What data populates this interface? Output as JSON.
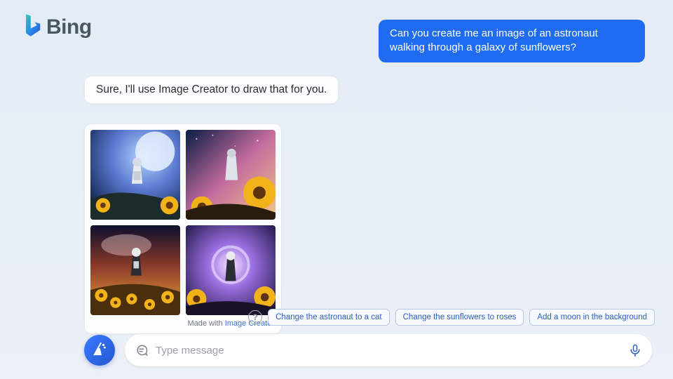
{
  "brand": {
    "name": "Bing"
  },
  "chat": {
    "user_message": "Can you create me an image of an astronaut walking through a galaxy of sunflowers?",
    "bot_message": "Sure, I'll use Image Creator to draw that for you.",
    "attribution_prefix": "Made with ",
    "attribution_link": "Image Creator"
  },
  "suggestions": {
    "items": [
      "Change the astronaut to a cat",
      "Change the sunflowers to roses",
      "Add a moon in the background"
    ]
  },
  "composer": {
    "placeholder": "Type message"
  },
  "icons": {
    "logo": "bing-logo-icon",
    "help": "help-icon",
    "broom": "broom-icon",
    "chat": "chat-bubble-icon",
    "mic": "microphone-icon"
  }
}
